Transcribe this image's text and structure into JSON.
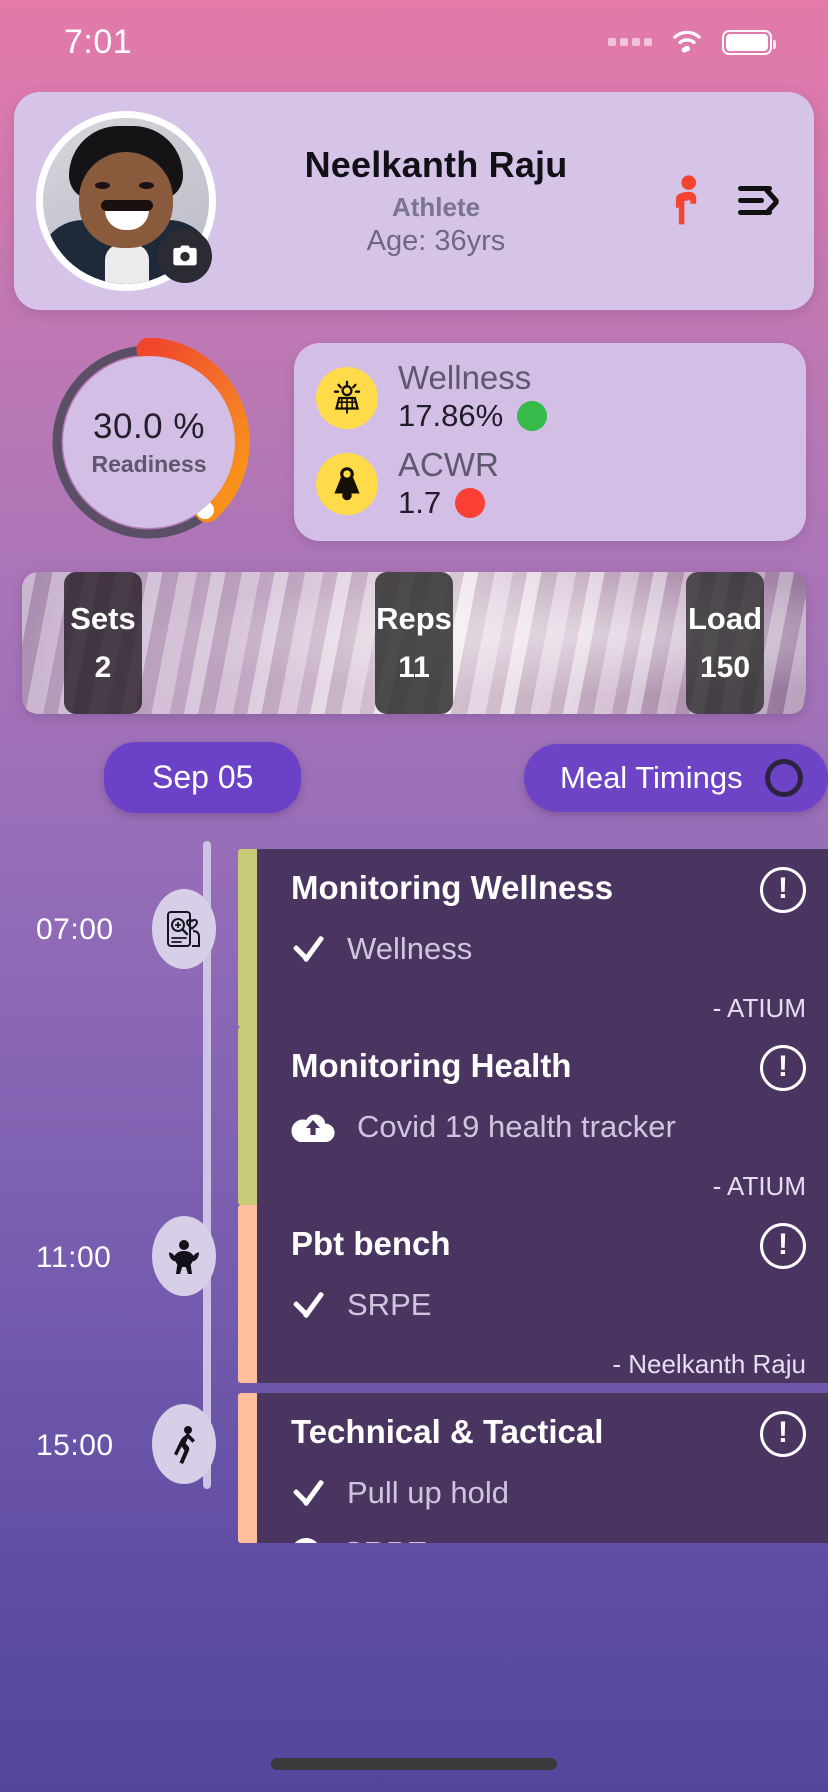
{
  "status_bar": {
    "time": "7:01",
    "signal_icon": "signal-dots-icon",
    "wifi_icon": "wifi-icon",
    "battery_icon": "battery-icon"
  },
  "profile": {
    "name": "Neelkanth Raju",
    "role": "Athlete",
    "age": "Age: 36yrs",
    "avatar_alt": "athlete-photo",
    "camera_icon": "camera-icon",
    "person_icon": "person-running-icon",
    "menu_icon": "menu-collapse-icon"
  },
  "readiness": {
    "value": "30.0 %",
    "label": "Readiness",
    "percent": 30,
    "arc_color_start": "#f04a2a",
    "arc_color_end": "#f89a18",
    "track_color": "#5b4f66",
    "face_color": "#d3bee6"
  },
  "stats": {
    "items": [
      {
        "icon": "sun-panel-icon",
        "title": "Wellness",
        "value": "17.86%",
        "status_color": "#37bb4a",
        "badge_color": "#ffdb4a"
      },
      {
        "icon": "weight-kettlebell-icon",
        "title": "ACWR",
        "value": "1.7",
        "status_color": "#fa4034",
        "badge_color": "#ffdb4a"
      }
    ]
  },
  "workout_banner": {
    "tiles": [
      {
        "label": "Sets",
        "value": "2"
      },
      {
        "label": "Reps",
        "value": "11"
      },
      {
        "label": "Load",
        "value": "150"
      }
    ]
  },
  "controls": {
    "date_pill": "Sep 05",
    "meal_pill": "Meal Timings",
    "meal_toggle_icon": "circle-outline-icon",
    "pill_color": "#6b41c8"
  },
  "timeline": {
    "entries": [
      {
        "time": "07:00",
        "node_icon": "mobile-health-monitor-icon",
        "cards": [
          {
            "title": "Monitoring Wellness",
            "accent": "#c8cc79",
            "item_icon": "check-icon",
            "item_label": "Wellness",
            "attribution": "- ATIUM",
            "alert_icon": "exclamation-circle-icon",
            "alert_glyph": "!"
          },
          {
            "title": "Monitoring Health",
            "accent": "#c8cc79",
            "item_icon": "cloud-upload-icon",
            "item_label": "Covid 19 health tracker",
            "attribution": "- ATIUM",
            "alert_icon": "exclamation-circle-icon",
            "alert_glyph": "!"
          }
        ]
      },
      {
        "time": "11:00",
        "node_icon": "bodybuilder-icon",
        "cards": [
          {
            "title": "Pbt bench",
            "accent": "#ffbf9c",
            "item_icon": "check-icon",
            "item_label": "SRPE",
            "attribution": "- Neelkanth Raju",
            "alert_icon": "exclamation-circle-icon",
            "alert_glyph": "!"
          }
        ]
      },
      {
        "time": "15:00",
        "node_icon": "athlete-jump-icon",
        "cards": [
          {
            "title": "Technical & Tactical",
            "accent": "#ffbf9c",
            "item_icon": "check-icon",
            "item_label": "Pull up hold",
            "second_item_icon": "dot-icon",
            "second_item_label": "SRPE",
            "attribution": "",
            "alert_icon": "exclamation-circle-icon",
            "alert_glyph": "!"
          }
        ]
      }
    ]
  }
}
